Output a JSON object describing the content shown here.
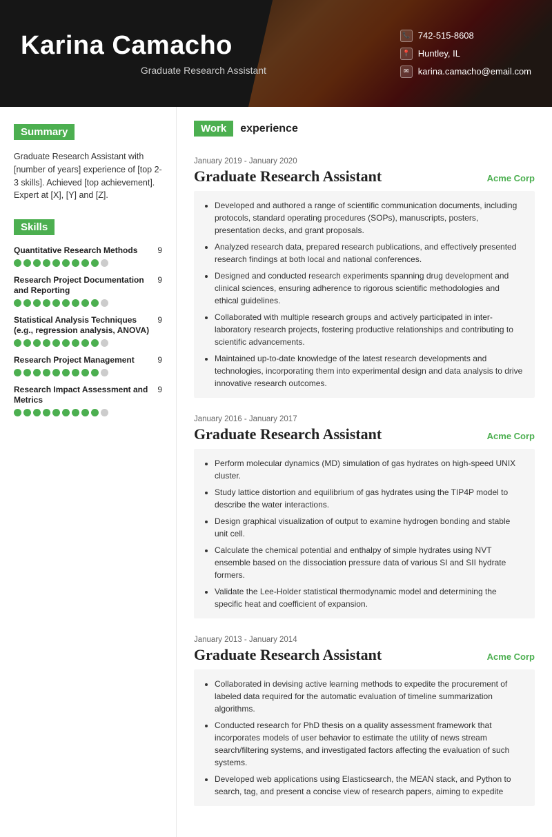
{
  "header": {
    "name": "Karina Camacho",
    "title": "Graduate Research Assistant",
    "phone": "742-515-8608",
    "location": "Huntley, IL",
    "email": "karina.camacho@email.com"
  },
  "summary": {
    "label": "Summary",
    "text": "Graduate Research Assistant with [number of years] experience of [top 2-3 skills]. Achieved [top achievement]. Expert at [X], [Y] and [Z]."
  },
  "skills": {
    "label": "Skills",
    "items": [
      {
        "name": "Quantitative Research Methods",
        "score": 9,
        "filled": 9,
        "empty": 1
      },
      {
        "name": "Research Project Documentation and Reporting",
        "score": 9,
        "filled": 9,
        "empty": 1
      },
      {
        "name": "Statistical Analysis Techniques (e.g., regression analysis, ANOVA)",
        "score": 9,
        "filled": 9,
        "empty": 1
      },
      {
        "name": "Research Project Management",
        "score": 9,
        "filled": 9,
        "empty": 1
      },
      {
        "name": "Research Impact Assessment and Metrics",
        "score": 9,
        "filled": 9,
        "empty": 1
      }
    ]
  },
  "work_experience": {
    "label": "Work experience",
    "jobs": [
      {
        "dates": "January 2019 - January 2020",
        "title": "Graduate Research Assistant",
        "company": "Acme Corp",
        "bullets": [
          "Developed and authored a range of scientific communication documents, including protocols, standard operating procedures (SOPs), manuscripts, posters, presentation decks, and grant proposals.",
          "Analyzed research data, prepared research publications, and effectively presented research findings at both local and national conferences.",
          "Designed and conducted research experiments spanning drug development and clinical sciences, ensuring adherence to rigorous scientific methodologies and ethical guidelines.",
          "Collaborated with multiple research groups and actively participated in inter-laboratory research projects, fostering productive relationships and contributing to scientific advancements.",
          "Maintained up-to-date knowledge of the latest research developments and technologies, incorporating them into experimental design and data analysis to drive innovative research outcomes."
        ]
      },
      {
        "dates": "January 2016 - January 2017",
        "title": "Graduate Research Assistant",
        "company": "Acme Corp",
        "bullets": [
          "Perform molecular dynamics (MD) simulation of gas hydrates on high-speed UNIX cluster.",
          "Study lattice distortion and equilibrium of gas hydrates using the TIP4P model to describe the water interactions.",
          "Design graphical visualization of output to examine hydrogen bonding and stable unit cell.",
          "Calculate the chemical potential and enthalpy of simple hydrates using NVT ensemble based on the dissociation pressure data of various SI and SII hydrate formers.",
          "Validate the Lee-Holder statistical thermodynamic model and determining the specific heat and coefficient of expansion."
        ]
      },
      {
        "dates": "January 2013 - January 2014",
        "title": "Graduate Research Assistant",
        "company": "Acme Corp",
        "bullets": [
          "Collaborated in devising active learning methods to expedite the procurement of labeled data required for the automatic evaluation of timeline summarization algorithms.",
          "Conducted research for PhD thesis on a quality assessment framework that incorporates models of user behavior to estimate the utility of news stream search/filtering systems, and investigated factors affecting the evaluation of such systems.",
          "Developed web applications using Elasticsearch, the MEAN stack, and Python to search, tag, and present a concise view of research papers, aiming to expedite"
        ]
      }
    ]
  }
}
